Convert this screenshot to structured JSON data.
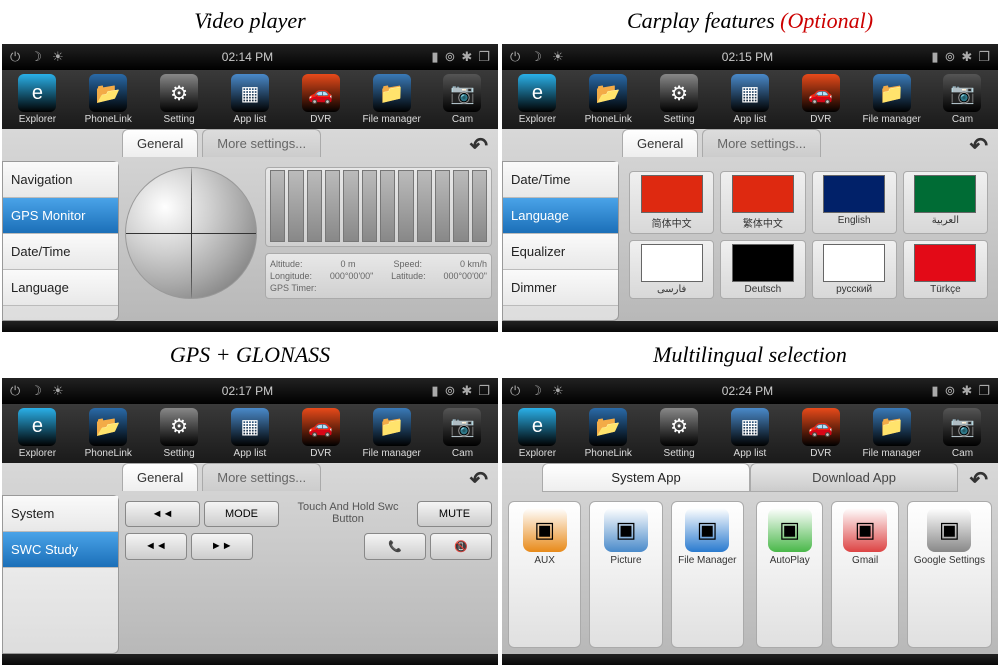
{
  "titles": {
    "p1": "Video player",
    "p2_main": "Carplay features",
    "p2_opt": "(Optional)",
    "p3": "GPS + GLONASS",
    "p4": "Multilingual selection"
  },
  "toolbar": [
    {
      "label": "Explorer",
      "icon": "e",
      "color": "#2ab0e8"
    },
    {
      "label": "PhoneLink",
      "icon": "folder",
      "color": "#2a6aa8"
    },
    {
      "label": "Setting",
      "icon": "gear",
      "color": "#888"
    },
    {
      "label": "App list",
      "icon": "grid",
      "color": "#4a8aca"
    },
    {
      "label": "DVR",
      "icon": "car",
      "color": "#e84a1a"
    },
    {
      "label": "File manager",
      "icon": "files",
      "color": "#3a7ab8"
    },
    {
      "label": "Cam",
      "icon": "cam",
      "color": "#555"
    }
  ],
  "panel1": {
    "time": "02:14 PM",
    "tabs": [
      "General",
      "More settings..."
    ],
    "sidebar": [
      "Navigation",
      "GPS Monitor",
      "Date/Time",
      "Language"
    ],
    "active_idx": 1,
    "gps": {
      "alt_k": "Altitude:",
      "alt_v": "0 m",
      "spd_k": "Speed:",
      "spd_v": "0 km/h",
      "lon_k": "Longitude:",
      "lon_v": "000°00'00\"",
      "lat_k": "Latitude:",
      "lat_v": "000°00'00\"",
      "timer_k": "GPS Timer:"
    }
  },
  "panel2": {
    "time": "02:15 PM",
    "tabs": [
      "General",
      "More settings..."
    ],
    "sidebar": [
      "Date/Time",
      "Language",
      "Equalizer",
      "Dimmer"
    ],
    "active_idx": 1,
    "flags": [
      {
        "label": "简体中文",
        "bg": "#de2910"
      },
      {
        "label": "繁体中文",
        "bg": "#de2910"
      },
      {
        "label": "English",
        "bg": "#012169"
      },
      {
        "label": "العربية",
        "bg": "#006c35"
      },
      {
        "label": "فارسی",
        "bg": "#fff"
      },
      {
        "label": "Deutsch",
        "bg": "#000"
      },
      {
        "label": "русский",
        "bg": "#fff"
      },
      {
        "label": "Türkçe",
        "bg": "#e30a17"
      }
    ]
  },
  "panel3": {
    "time": "02:17 PM",
    "tabs": [
      "General",
      "More settings..."
    ],
    "sidebar": [
      "System",
      "SWC Study"
    ],
    "active_idx": 1,
    "swc_header": "Touch And Hold Swc Button",
    "swc_btns": [
      "MODE",
      "MUTE"
    ],
    "swc_btns2": [
      "◄◄",
      "►►",
      "📞",
      "📵"
    ]
  },
  "panel4": {
    "time": "02:24 PM",
    "tabs": [
      "System App",
      "Download App"
    ],
    "active_tab": 0,
    "left_apps": [
      {
        "label": "AUX",
        "color": "#e88a1a"
      },
      {
        "label": "Picture",
        "color": "#4a8aca"
      },
      {
        "label": "File Manager",
        "color": "#2a7acf"
      }
    ],
    "right_apps": [
      {
        "label": "AutoPlay",
        "color": "#4ab84a"
      },
      {
        "label": "Gmail",
        "color": "#d44"
      },
      {
        "label": "Google Settings",
        "color": "#888"
      }
    ]
  }
}
